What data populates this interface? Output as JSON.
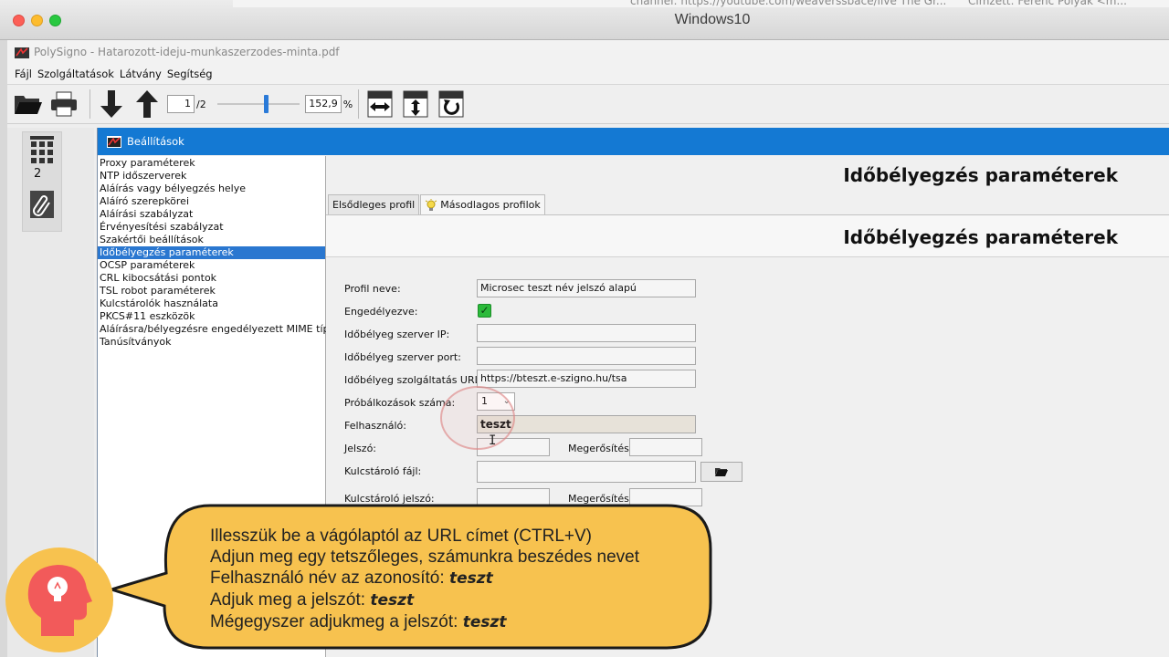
{
  "mac": {
    "window_title": "Windows10",
    "background_tab_text": "channel: https://youtube.com/weaverssbace/live The Gr...",
    "background_right_text": "Címzett:  Ferenc Polyák <m..."
  },
  "app": {
    "title": "PolySigno - Hatarozott-ideju-munkaszerzodes-minta.pdf",
    "menu": [
      "Fájl",
      "Szolgáltatások",
      "Látvány",
      "Segítség"
    ],
    "toolbar": {
      "page_current": "1",
      "page_total": "/2",
      "zoom_value": "152,9",
      "zoom_unit": "%",
      "zoom_level": 0.6
    },
    "thumb_page": "2"
  },
  "dialog": {
    "title": "Beállítások",
    "list_items": [
      "Proxy paraméterek",
      "NTP időszerverek",
      "Aláírás vagy bélyegzés helye",
      "Aláíró szerepkörei",
      "Aláírási szabályzat",
      "Érvényesítési szabályzat",
      "Szakértői beállítások",
      "Időbélyegzés paraméterek",
      "OCSP paraméterek",
      "CRL kibocsátási pontok",
      "TSL robot paraméterek",
      "Kulcstárolók használata",
      "PKCS#11 eszközök",
      "Aláírásra/bélyegzésre engedélyezett MIME típusok",
      "Tanúsítványok"
    ],
    "selected_index": 7,
    "section_title": "Időbélyegzés paraméterek",
    "tabs": [
      "Elsődleges profil",
      "Másodlagos profilok"
    ],
    "inner_title": "Időbélyegzés paraméterek",
    "form": {
      "profile_name_label": "Profil neve:",
      "profile_name_value": "Microsec teszt név jelszó alapú",
      "enabled_label": "Engedélyezve:",
      "enabled_mark": "✓",
      "server_ip_label": "Időbélyeg szerver IP:",
      "server_ip_value": "",
      "server_port_label": "Időbélyeg szerver port:",
      "server_port_value": "",
      "service_url_label": "Időbélyeg szolgáltatás URL:",
      "service_url_value": "https://bteszt.e-szigno.hu/tsa",
      "attempts_label": "Próbálkozások száma:",
      "attempts_value": "1",
      "user_label": "Felhasználó:",
      "user_value": "teszt",
      "password_label": "Jelszó:",
      "password_confirm_label": "Megerősítés:",
      "keystore_file_label": "Kulcstároló fájl:",
      "keystore_password_label": "Kulcstároló jelszó:",
      "keystore_confirm_label": "Megerősítés:"
    }
  },
  "tooltip": {
    "line1": "Illesszük be a vágólaptól az URL címet (CTRL+V)",
    "line2": "Adjun meg egy tetszőleges, számunkra beszédes nevet",
    "line3_text": "Felhasználó név az azonosító: ",
    "line3_bold": "teszt",
    "line4_text": "Adjuk meg a jelszót: ",
    "line4_bold": "teszt",
    "line5_text": "Mégegyszer adjukmeg a jelszót: ",
    "line5_bold": "teszt"
  }
}
